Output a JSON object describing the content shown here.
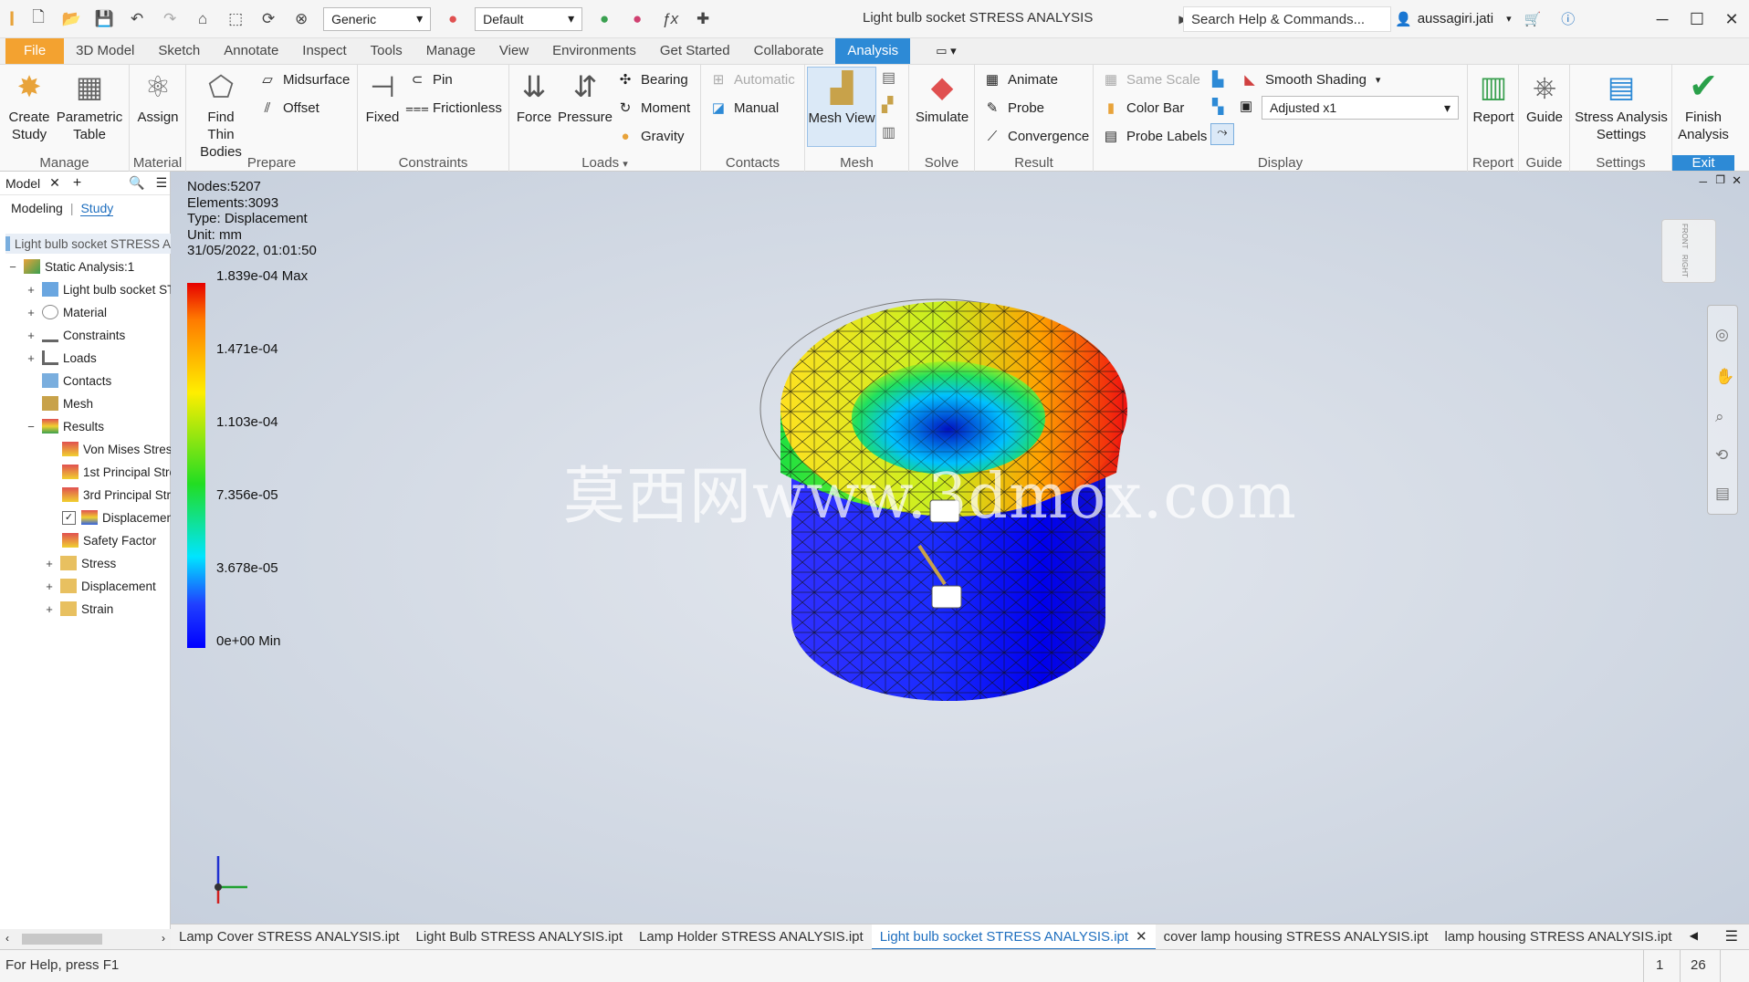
{
  "titlebar": {
    "app_logo": "I",
    "material_select": "Generic",
    "appearance_select": "Default",
    "title": "Light bulb socket STRESS ANALYSIS",
    "search_placeholder": "Search Help & Commands...",
    "user": "aussagiri.jati"
  },
  "tabs": [
    "File",
    "3D Model",
    "Sketch",
    "Annotate",
    "Inspect",
    "Tools",
    "Manage",
    "View",
    "Environments",
    "Get Started",
    "Collaborate",
    "Analysis"
  ],
  "active_tab": "Analysis",
  "ribbon": {
    "manage": {
      "label": "Manage",
      "create_study": "Create Study",
      "parametric_table": "Parametric Table"
    },
    "material": {
      "label": "Material",
      "assign": "Assign"
    },
    "prepare": {
      "label": "Prepare",
      "find_thin_bodies": "Find Thin Bodies",
      "midsurface": "Midsurface",
      "offset": "Offset"
    },
    "constraints": {
      "label": "Constraints",
      "fixed": "Fixed",
      "pin": "Pin",
      "frictionless": "Frictionless"
    },
    "loads": {
      "label": "Loads",
      "force": "Force",
      "pressure": "Pressure",
      "bearing": "Bearing",
      "moment": "Moment",
      "gravity": "Gravity"
    },
    "contacts": {
      "label": "Contacts",
      "automatic": "Automatic",
      "manual": "Manual"
    },
    "mesh": {
      "label": "Mesh",
      "mesh_view": "Mesh View"
    },
    "solve": {
      "label": "Solve",
      "simulate": "Simulate"
    },
    "result": {
      "label": "Result",
      "animate": "Animate",
      "probe": "Probe",
      "convergence": "Convergence"
    },
    "display": {
      "label": "Display",
      "same_scale": "Same Scale",
      "color_bar": "Color Bar",
      "probe_labels": "Probe Labels",
      "shading": "Smooth Shading",
      "adjusted": "Adjusted x1"
    },
    "report": {
      "label": "Report",
      "report": "Report"
    },
    "guide": {
      "label": "Guide",
      "guide": "Guide"
    },
    "settings": {
      "label": "Settings",
      "stress_settings": "Stress Analysis Settings"
    },
    "exit": {
      "label": "Exit",
      "finish": "Finish Analysis"
    }
  },
  "browser": {
    "tab_model": "Model",
    "modeling": "Modeling",
    "study": "Study",
    "root": "Light bulb socket STRESS A",
    "items": [
      "Static Analysis:1",
      "Light bulb socket ST",
      "Material",
      "Constraints",
      "Loads",
      "Contacts",
      "Mesh",
      "Results",
      "Von Mises Stress",
      "1st Principal Stre",
      "3rd Principal Stre",
      "Displacemen",
      "Safety Factor",
      "Stress",
      "Displacement",
      "Strain"
    ]
  },
  "viewport": {
    "nodes": "Nodes:5207",
    "elements": "Elements:3093",
    "type": "Type: Displacement",
    "unit": "Unit: mm",
    "datetime": "31/05/2022, 01:01:50",
    "colorbar_labels": [
      "1.839e-04 Max",
      "1.471e-04",
      "1.103e-04",
      "7.356e-05",
      "3.678e-05",
      "0e+00 Min"
    ],
    "watermark": "莫西网www.3dmox.com",
    "viewcube_front": "FRONT",
    "viewcube_right": "RIGHT"
  },
  "doc_tabs": [
    "Lamp Cover STRESS ANALYSIS.ipt",
    "Light Bulb STRESS ANALYSIS.ipt",
    "Lamp Holder STRESS ANALYSIS.ipt",
    "Light bulb socket STRESS ANALYSIS.ipt",
    "cover lamp housing STRESS ANALYSIS.ipt",
    "lamp housing STRESS ANALYSIS.ipt"
  ],
  "active_doc": 3,
  "status": {
    "help": "For Help, press F1",
    "num1": "1",
    "num2": "26"
  }
}
